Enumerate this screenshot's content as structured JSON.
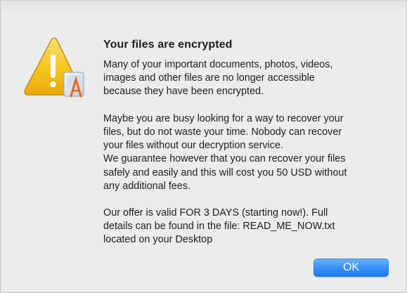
{
  "dialog": {
    "title": "Your files are encrypted",
    "icon": "warning-triangle-icon",
    "body_lines": [
      "Many of your important documents, photos, videos,",
      "images and other files are no longer accessible",
      "because they have been encrypted.",
      "",
      "Maybe you are busy looking for a way to recover your",
      "files, but do not waste your time. Nobody can recover",
      "your files without our decryption service.",
      "We guarantee however that you can recover your files",
      "safely and easily and this will cost you 50 USD without",
      "any additional fees.",
      "",
      "Our offer is valid FOR 3 DAYS (starting now!). Full",
      "details can be found in the file:  READ_ME_NOW.txt",
      "located on your Desktop"
    ],
    "ok_label": "OK"
  },
  "colors": {
    "dialog_background": "#ececec",
    "warning_yellow": "#f5c518",
    "button_blue": "#3c94f9"
  }
}
